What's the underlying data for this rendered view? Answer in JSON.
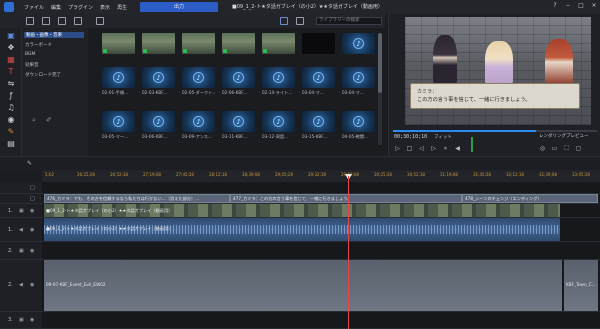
{
  "menubar": {
    "items": [
      "ファイル",
      "編集",
      "プラグイン",
      "表示",
      "再生"
    ],
    "publish_label": "出力",
    "title": "■09_1_2-ト★タ話ガブレイ（の小2）★★タ話ガブレイ（動画用）",
    "window_controls": [
      "?",
      "‒",
      "□",
      "×"
    ]
  },
  "library": {
    "search_placeholder": "ライブラリーの検索",
    "categories": [
      "動画・画像・音楽",
      "カラーボード",
      "BGM",
      "効果音",
      "ダウンロード完了"
    ],
    "tiles": [
      {
        "kind": "img",
        "label": ""
      },
      {
        "kind": "img",
        "label": ""
      },
      {
        "kind": "img",
        "label": ""
      },
      {
        "kind": "img",
        "label": ""
      },
      {
        "kind": "img",
        "label": ""
      },
      {
        "kind": "dark",
        "label": ""
      },
      {
        "kind": "music",
        "label": ""
      },
      {
        "kind": "music",
        "label": "02-01-手順..."
      },
      {
        "kind": "music",
        "label": "02-03-KBF..."
      },
      {
        "kind": "music",
        "label": "02-05-ダークト..."
      },
      {
        "kind": "music",
        "label": "02-06-KBF..."
      },
      {
        "kind": "music",
        "label": "02-14-ライト..."
      },
      {
        "kind": "music",
        "label": "03-04-マ..."
      },
      {
        "kind": "music",
        "label": "03-04-マ..."
      },
      {
        "kind": "music",
        "label": "03-05-マー..."
      },
      {
        "kind": "music",
        "label": "03-06-KBF..."
      },
      {
        "kind": "music",
        "label": "03-09-アンス..."
      },
      {
        "kind": "music",
        "label": "03-11-KBF..."
      },
      {
        "kind": "music",
        "label": "03-12-洞窟..."
      },
      {
        "kind": "music",
        "label": "03-15-KBF..."
      },
      {
        "kind": "music",
        "label": "04-05-戦闘..."
      }
    ]
  },
  "preview": {
    "speaker": "カミラ：",
    "dialog_line": "この方の言う事を信じて、一緒に行きましょう。",
    "timecode": "00;30;10;10",
    "fit_label": "フィット",
    "render_label": "レンダリングプレビュー"
  },
  "timeline": {
    "ruler": [
      "5;02",
      "26;25;28",
      "26;52;18",
      "27;19;08",
      "27;45;28",
      "28;12;18",
      "28;39;08",
      "29;05;28",
      "29;32;18",
      "29;59;08",
      "30;25;28",
      "30;52;18",
      "31;19;08",
      "31;45;28",
      "32;12;18",
      "32;39;08",
      "33;05;28"
    ],
    "title_clips": [
      {
        "text": "476_カミラ：でも、その方を信頼するなら私たちは行かない…（消えた部分）…"
      },
      {
        "text": "477_カミラ：この方の言う事を信じて、一緒に行きましょう。"
      },
      {
        "text": "478_シーンのチェンジ（エンディング）"
      }
    ],
    "video_clip": "■09_1_2-ト★タ話ガブレイ（の小2）★★タ話ガブレイ（動画用）",
    "audio_clip": "■09_1_2-ト★タ話ガブレイ（の小2）★★タ話ガブレイ（動画用）",
    "long_audio": "09-07-KBF_Event_Evil_EW02",
    "long_audio_2": "KBF_Town_C...",
    "track_numbers": [
      "1.",
      "1.",
      "2.",
      "2.",
      "3."
    ]
  }
}
